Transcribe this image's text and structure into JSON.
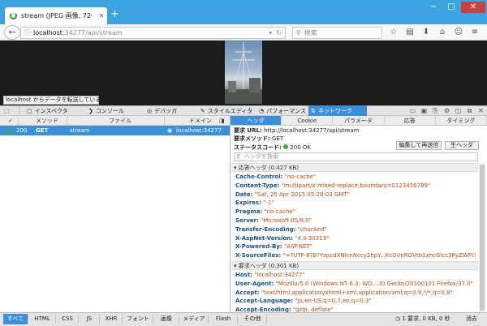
{
  "browser": {
    "tab_title": "stream (JPEG 画像, 720...",
    "new_tab_glyph": "+",
    "window_controls": {
      "minimize": "−",
      "maximize": "□",
      "close": "✕"
    },
    "url_host": "localhost",
    "url_path": ":34277/api/stream",
    "search_placeholder": "検索",
    "status_text": "localhost からデータを転送しています..."
  },
  "devtools": {
    "toolbar": {
      "inspector": "インスペクタ",
      "console": "コンソール",
      "debugger": "デバッガ",
      "style_editor": "スタイルエディタ",
      "performance": "パフォーマンス",
      "network": "ネットワーク"
    },
    "columns": {
      "check": "✓",
      "method": "メソッド",
      "file": "ファイル",
      "domain": "ドメイン"
    },
    "request": {
      "status": "200",
      "method": "GET",
      "file": "stream",
      "domain": "localhost:34277"
    },
    "pane_tabs": [
      "ヘッダ",
      "Cookie",
      "パラメータ",
      "応答",
      "タイミング"
    ],
    "summary": {
      "url_label": "要求 URL:",
      "url_value": "http://localhost:34277/api/stream",
      "method_label": "要求メソッド:",
      "method_value": "GET",
      "status_label": "ステータスコード:",
      "status_value": "200 OK"
    },
    "buttons": {
      "edit_resend": "編集して再送信",
      "raw_headers": "生ヘッダ"
    },
    "filter_placeholder": "ヘッダを検索",
    "response_section": "▾ 応答ヘッダ (0.427 KB)",
    "response_headers": [
      {
        "name": "Cache-Control:",
        "value": "\"no-cache\""
      },
      {
        "name": "Content-Type:",
        "value": "\"multipart/x-mixed-replace;boundary=0123456789\""
      },
      {
        "name": "Date:",
        "value": "\"Sat, 25 Apr 2015 05:28:03 GMT\""
      },
      {
        "name": "Expires:",
        "value": "\"-1\""
      },
      {
        "name": "Pragma:",
        "value": "\"no-cache\""
      },
      {
        "name": "Server:",
        "value": "\"Microsoft-IIS/8.0\""
      },
      {
        "name": "Transfer-Encoding:",
        "value": "\"chunked\""
      },
      {
        "name": "X-AspNet-Version:",
        "value": "\"4.0.30319\""
      },
      {
        "name": "X-Powered-By:",
        "value": "\"ASP.NET\""
      },
      {
        "name": "X-SourceFiles:",
        "value": "\"=?UTF-8?B?YzpcdXNlcnNccy2hpY...KcGVnRGVtb1xhcGlcc3RyZWFt?=\""
      }
    ],
    "request_section": "▾ 要求ヘッダ (0.301 KB)",
    "request_headers": [
      {
        "name": "Host:",
        "value": "\"localhost:34277\""
      },
      {
        "name": "User-Agent:",
        "value": "\"Mozilla/5.0 (Windows NT 6.3; WO....0) Gecko/20100101 Firefox/37.0\""
      },
      {
        "name": "Accept:",
        "value": "\"text/html,application/xhtml+xml,application/xml;q=0.9,*/*;q=0.8\""
      },
      {
        "name": "Accept-Language:",
        "value": "\"ja,en-US;q=0.7,en;q=0.3\""
      },
      {
        "name": "Accept-Encoding:",
        "value": "\"gzip, deflate\""
      }
    ],
    "filters": [
      "すべて",
      "HTML",
      "CSS",
      "JS",
      "XHR",
      "フォント",
      "画像",
      "メディア",
      "Flash",
      "その他"
    ],
    "footer_summary": "1 要求, 0 KB, 0 秒",
    "clear": "消去"
  },
  "colors": {
    "accent": "#3c8fd8",
    "tabstrip": "#3aa3e0",
    "status_ok": "#36b043",
    "header_name": "#1b4c8c",
    "header_value": "#c14a14"
  }
}
